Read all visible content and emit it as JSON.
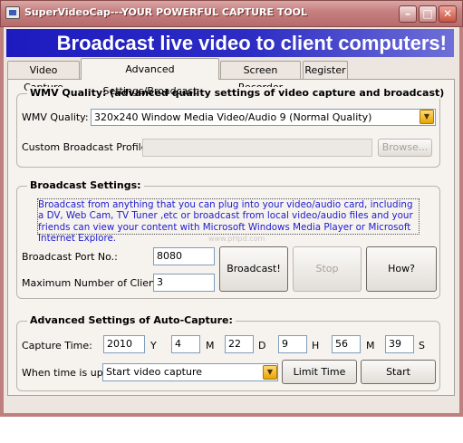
{
  "window": {
    "title": "SuperVideoCap---YOUR POWERFUL CAPTURE TOOL",
    "min_symbol": "–",
    "max_symbol": "□",
    "close_symbol": "✕"
  },
  "banner": "Broadcast live video to client computers!",
  "tabs": [
    {
      "label": "Video Capture",
      "active": false
    },
    {
      "label": "Advanced Settings/Broadcast",
      "active": true
    },
    {
      "label": "Screen Recorder",
      "active": false
    },
    {
      "label": "Register",
      "active": false
    }
  ],
  "wmv": {
    "group_title": "WMV Quality: (advanced quality settings of video capture and broadcast)",
    "quality_label": "WMV Quality:",
    "quality_value": "320x240 Window Media Video/Audio 9 (Normal Quality)",
    "profile_label": "Custom Broadcast Profile:",
    "profile_value": "",
    "browse_label": "Browse..."
  },
  "broadcast": {
    "group_title": "Broadcast Settings:",
    "description": "Broadcast from anything that you can plug into your video/audio card, including a DV, Web Cam, TV Tuner ,etc or broadcast from local video/audio files and your friends can view your content with Microsoft Windows Media Player or Microsoft Internet Explore.",
    "port_label": "Broadcast Port No.:",
    "port_value": "8080",
    "clients_label": "Maximum Number of Clients:",
    "clients_value": "3",
    "broadcast_button": "Broadcast!",
    "stop_button": "Stop",
    "how_button": "How?"
  },
  "watermark": "www.pHpd.com",
  "auto_capture": {
    "group_title": "Advanced Settings of Auto-Capture:",
    "time_label": "Capture Time:",
    "year": "2010",
    "year_unit": "Y",
    "month": "4",
    "month_unit": "M",
    "day": "22",
    "day_unit": "D",
    "hour": "9",
    "hour_unit": "H",
    "minute": "56",
    "minute_unit": "M",
    "second": "39",
    "second_unit": "S",
    "action_label": "When time is up:",
    "action_value": "Start video capture",
    "limit_button": "Limit Time",
    "start_button": "Start"
  },
  "colors": {
    "title_bar": "#c78080",
    "banner": "#1d1bbf",
    "description_text": "#1c1cd0"
  }
}
